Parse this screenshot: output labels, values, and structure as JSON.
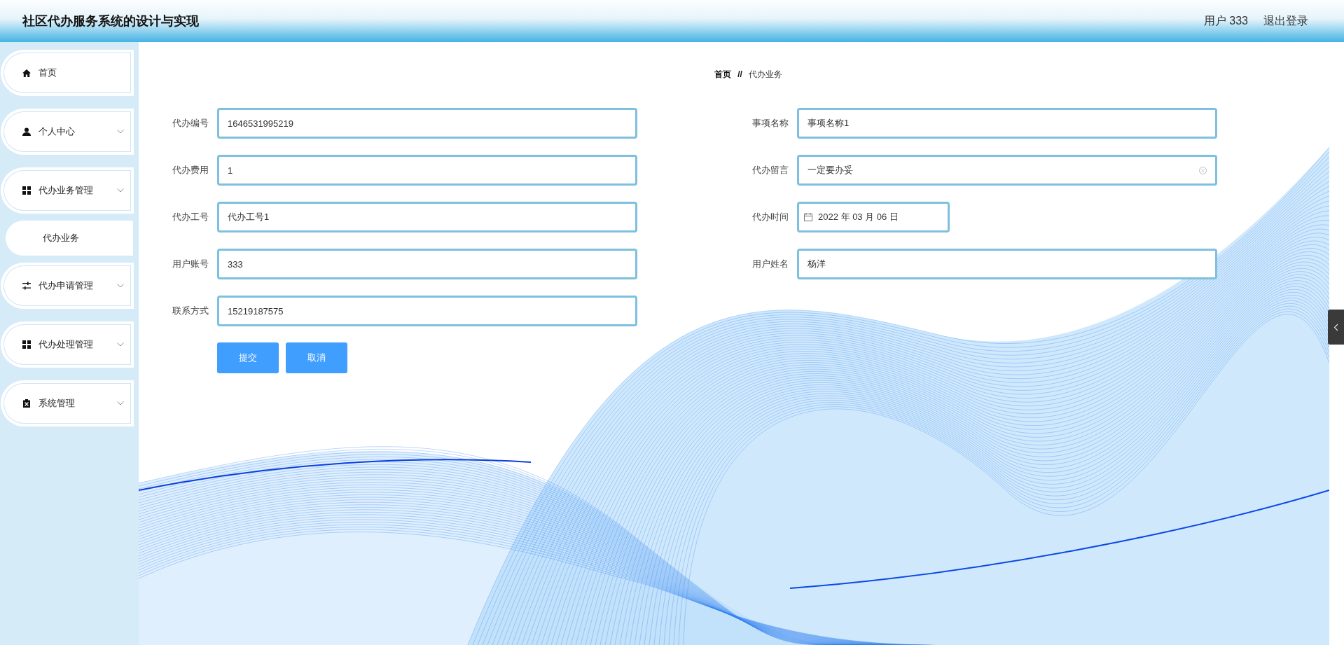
{
  "header": {
    "title": "社区代办服务系统的设计与实现",
    "user": "用户 333",
    "logout": "退出登录"
  },
  "sidebar": {
    "items": [
      {
        "label": "首页",
        "kind": "link"
      },
      {
        "label": "个人中心",
        "kind": "submenu"
      },
      {
        "label": "代办业务管理",
        "kind": "submenu",
        "children": [
          {
            "label": "代办业务"
          }
        ]
      },
      {
        "label": "代办申请管理",
        "kind": "submenu"
      },
      {
        "label": "代办处理管理",
        "kind": "submenu"
      },
      {
        "label": "系统管理",
        "kind": "submenu"
      }
    ]
  },
  "breadcrumb": {
    "items": [
      "首页",
      "代办业务"
    ],
    "separator": "//"
  },
  "form": {
    "fields": [
      {
        "label": "代办编号",
        "value": "1646531995219",
        "kind": "text"
      },
      {
        "label": "事项名称",
        "value": "事项名称1",
        "kind": "text"
      },
      {
        "label": "代办费用",
        "value": "1",
        "kind": "text"
      },
      {
        "label": "代办留言",
        "value": "一定要办妥",
        "kind": "clearable"
      },
      {
        "label": "代办工号",
        "value": "代办工号1",
        "kind": "text"
      },
      {
        "label": "代办时间",
        "value": "2022 年 03 月 06 日",
        "kind": "date"
      },
      {
        "label": "用户账号",
        "value": "333",
        "kind": "text"
      },
      {
        "label": "用户姓名",
        "value": "杨洋",
        "kind": "text"
      },
      {
        "label": "联系方式",
        "value": "15219187575",
        "kind": "text"
      }
    ],
    "buttons": [
      {
        "label": "提交"
      },
      {
        "label": "取消"
      }
    ]
  }
}
